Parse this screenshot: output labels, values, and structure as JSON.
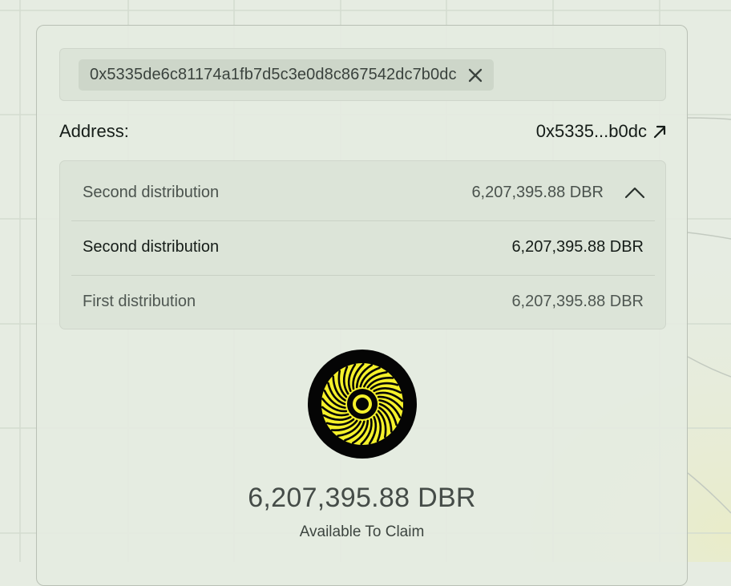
{
  "search": {
    "chip_text": "0x5335de6c81174a1fb7d5c3e0d8c867542dc7b0dc",
    "chip_close_icon": "close-icon"
  },
  "address": {
    "label": "Address:",
    "short_value": "0x5335...b0dc",
    "link_icon": "arrow-up-right-icon"
  },
  "distributions": {
    "selected": {
      "name": "Second distribution",
      "amount": "6,207,395.88 DBR",
      "toggle_icon": "chevron-up-icon"
    },
    "items": [
      {
        "name": "Second distribution",
        "amount": "6,207,395.88 DBR"
      },
      {
        "name": "First distribution",
        "amount": "6,207,395.88 DBR"
      }
    ]
  },
  "claim": {
    "token_icon": "dbr-token-logo",
    "amount": "6,207,395.88 DBR",
    "label": "Available To Claim"
  },
  "colors": {
    "background": "#e6ece2",
    "card": "#e5ece1",
    "panel": "#dce4d8",
    "chip": "#cdd6c9",
    "logo_yellow": "#f5f12a",
    "logo_black": "#050505"
  }
}
